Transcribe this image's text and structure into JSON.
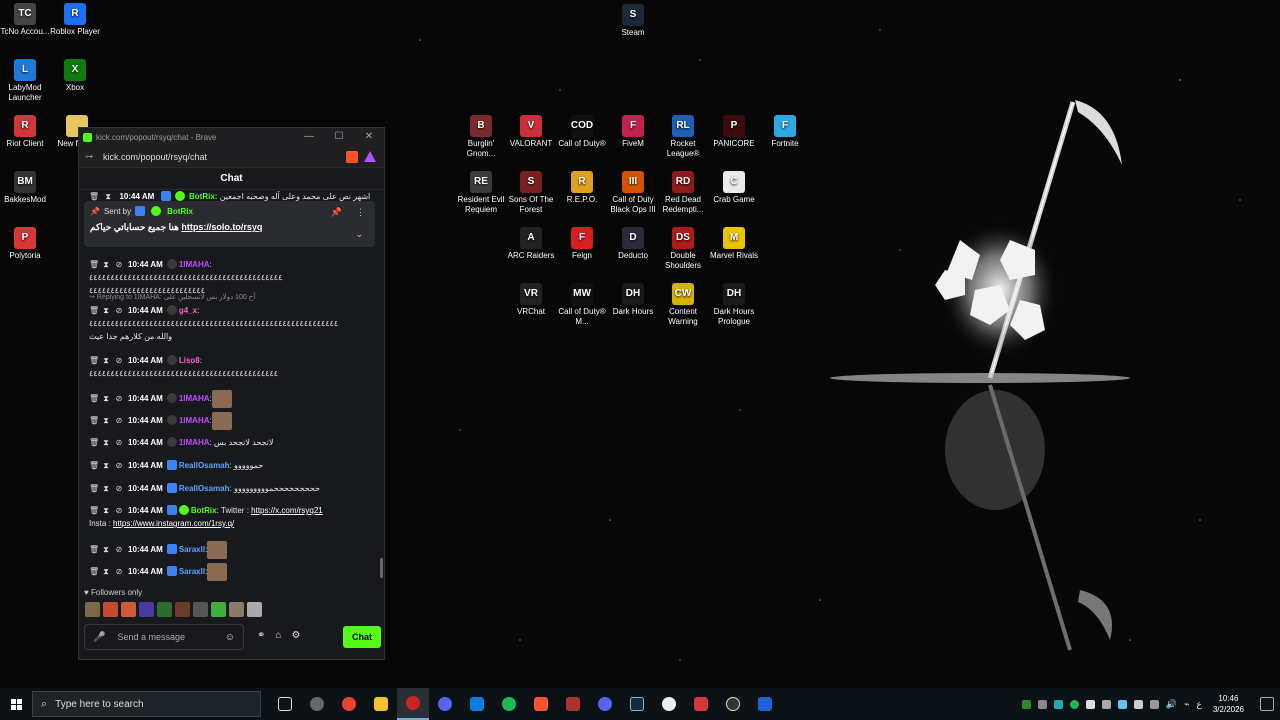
{
  "desktop": {
    "icons": [
      {
        "label": "TcNo Accou...",
        "color": "#444444",
        "glyph": "TC"
      },
      {
        "label": "Roblox Player",
        "color": "#1c6ff2",
        "glyph": "R"
      },
      {
        "label": "Steam",
        "color": "#1b2838",
        "glyph": "S"
      },
      {
        "label": "LabyMod Launcher",
        "color": "#1d7bd6",
        "glyph": "L"
      },
      {
        "label": "Xbox",
        "color": "#107c10",
        "glyph": "X"
      },
      {
        "label": "Riot Client",
        "color": "#d13639",
        "glyph": "R"
      },
      {
        "label": "New f... (3)",
        "color": "#e7c660",
        "glyph": ""
      },
      {
        "label": "BakkesMod",
        "color": "#333333",
        "glyph": "BM"
      },
      {
        "label": "Polytoria",
        "color": "#d93636",
        "glyph": "P"
      },
      {
        "label": "Burglin' Gnom...",
        "color": "#7a2a2a",
        "glyph": "B"
      },
      {
        "label": "VALORANT",
        "color": "#cc2f3c",
        "glyph": "V"
      },
      {
        "label": "Call of Duty®",
        "color": "#111111",
        "glyph": "COD"
      },
      {
        "label": "FiveM",
        "color": "#c51e4f",
        "glyph": "F"
      },
      {
        "label": "Rocket League®",
        "color": "#1f5fb5",
        "glyph": "RL"
      },
      {
        "label": "PANICORE",
        "color": "#3c0b0b",
        "glyph": "P"
      },
      {
        "label": "Fortnite",
        "color": "#2ba9e0",
        "glyph": "F"
      },
      {
        "label": "Resident Evil Requiem",
        "color": "#3b3b3b",
        "glyph": "RE"
      },
      {
        "label": "Sons Of The Forest",
        "color": "#7a1f1f",
        "glyph": "S"
      },
      {
        "label": "R.E.P.O.",
        "color": "#e0a020",
        "glyph": "R"
      },
      {
        "label": "Call of Duty Black Ops III",
        "color": "#d35400",
        "glyph": "III"
      },
      {
        "label": "Red Dead Redempti...",
        "color": "#8e1b1b",
        "glyph": "RD"
      },
      {
        "label": "Crab Game",
        "color": "#eaeaea",
        "glyph": "C"
      },
      {
        "label": "ARC Raiders",
        "color": "#222222",
        "glyph": "A"
      },
      {
        "label": "Feign",
        "color": "#d62020",
        "glyph": "F"
      },
      {
        "label": "Deducto",
        "color": "#2a2a3a",
        "glyph": "D"
      },
      {
        "label": "Double Shoulders",
        "color": "#b01a1a",
        "glyph": "DS"
      },
      {
        "label": "Marvel Rivals",
        "color": "#e9c200",
        "glyph": "M"
      },
      {
        "label": "VRChat",
        "color": "#222222",
        "glyph": "VR"
      },
      {
        "label": "Call of Duty® M...",
        "color": "#111111",
        "glyph": "MW"
      },
      {
        "label": "Dark Hours",
        "color": "#1a1a1a",
        "glyph": "DH"
      },
      {
        "label": "Content Warning",
        "color": "#d4b400",
        "glyph": "CW"
      },
      {
        "label": "Dark Hours Prologue",
        "color": "#1a1a1a",
        "glyph": "DH"
      }
    ]
  },
  "browser": {
    "title": "kick.com/popout/rsyq/chat - Brave",
    "url": "kick.com/popout/rsyq/chat",
    "controls": {
      "minimize": "—",
      "maximize": "☐",
      "close": "✕"
    }
  },
  "chat": {
    "header": "Chat",
    "pinned": {
      "sent_by": "Sent by",
      "author": "BotRix",
      "text": "هنا جميع حساباتي حياكم",
      "link": "https://solo.to/rsyq"
    },
    "top_partial": {
      "time": "10:44 AM",
      "user": "BotRix:",
      "text": "اشهر نص على محمد وعلى آله وصحبه اجمعين"
    },
    "messages": [
      {
        "time": "10:44 AM",
        "user": "1IMAHA",
        "user_color": "purple",
        "text": ": ٤٤٤٤٤٤٤٤٤٤٤٤٤٤٤٤٤٤٤٤٤٤٤٤٤٤٤٤٤٤٤٤٤٤٤٤٤٤٤٤٤٤٤٤٤",
        "text2": "٤٤٤٤٤٤٤٤٤٤٤٤٤٤٤٤٤٤٤٤٤٤٤٤٤٤٤"
      },
      {
        "reply": "Replying to 1IMAHA: آخ 100 دولار بس لاتسجلين على"
      },
      {
        "time": "10:44 AM",
        "user": "g4_x",
        "user_color": "pink",
        "text": ":",
        "text2": "٤٤٤٤٤٤٤٤٤٤٤٤٤٤٤٤٤٤٤٤٤٤٤٤٤٤٤٤٤٤٤٤٤٤٤٤٤٤٤٤٤٤٤٤٤٤٤٤٤٤٤٤٤٤٤٤٤٤",
        "text3": "والله من كلارهم جدا عيث"
      },
      {
        "time": "10:44 AM",
        "user": "Liso8",
        "user_color": "pink",
        "text": ":",
        "text2": "٤٤٤٤٤٤٤٤٤٤٤٤٤٤٤٤٤٤٤٤٤٤٤٤٤٤٤٤٤٤٤٤٤٤٤٤٤٤٤٤٤٤٤٤"
      },
      {
        "time": "10:44 AM",
        "user": "1IMAHA",
        "user_color": "purple",
        "text": ":"
      },
      {
        "time": "10:44 AM",
        "user": "1IMAHA",
        "user_color": "purple",
        "text": ":"
      },
      {
        "time": "10:44 AM",
        "user": "1IMAHA",
        "user_color": "purple",
        "text": ": لاتجحد لاتجحد بس"
      },
      {
        "time": "10:44 AM",
        "user": "ReallOsamah",
        "user_color": "blue",
        "text": ": حمووووو"
      },
      {
        "time": "10:44 AM",
        "user": "ReallOsamah",
        "user_color": "blue",
        "text": ": حححححححححمووووووووو"
      },
      {
        "time": "10:44 AM",
        "user": "BotRix",
        "user_color": "green",
        "text": ": Twitter : ",
        "link": "https://x.com/rsyq21",
        "text2": "Insta : ",
        "link2": "https://www.instagram.com/1rsy.q/"
      },
      {
        "time": "10:44 AM",
        "user": "Saraxll",
        "user_color": "blue",
        "text": ":"
      },
      {
        "time": "10:44 AM",
        "user": "Saraxll",
        "user_color": "blue",
        "text": ":"
      }
    ],
    "followers_only": "Followers only",
    "input_placeholder": "Send a message",
    "send_label": "Chat"
  },
  "taskbar": {
    "search_placeholder": "Type here to search",
    "time": "10:46",
    "date": "3/2/2026",
    "lang": "ع"
  }
}
